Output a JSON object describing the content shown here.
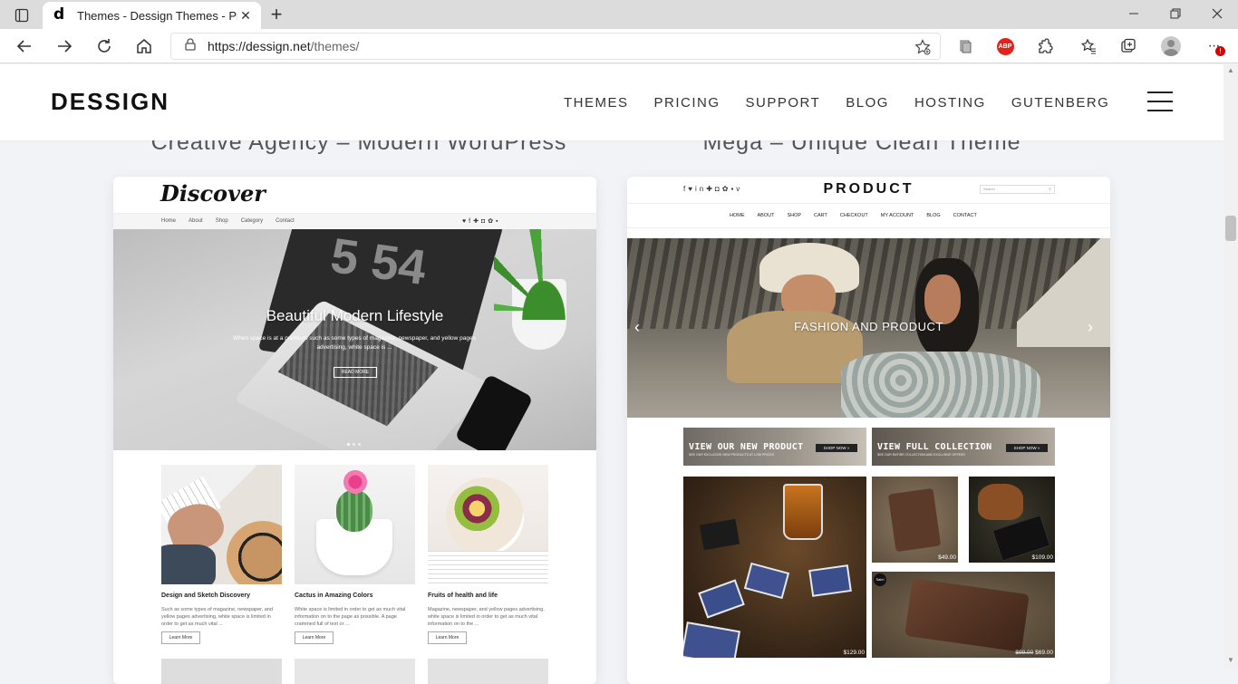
{
  "browser": {
    "tab_title": "Themes - Dessign Themes - Prem",
    "url_host": "https://dessign.net",
    "url_path": "/themes/",
    "abp_label": "ABP",
    "notif_badge": "!"
  },
  "site": {
    "logo": "DESSIGN",
    "nav": [
      "THEMES",
      "PRICING",
      "SUPPORT",
      "BLOG",
      "HOSTING",
      "GUTENBERG"
    ]
  },
  "cards": [
    {
      "title": "Creative Agency – Modern WordPress",
      "preview": {
        "brand": "Discover",
        "menu": [
          "Home",
          "About",
          "Shop",
          "Category",
          "Contact"
        ],
        "hero_title": "Beautiful Modern Lifestyle",
        "hero_text": "When space is at a premium such as some types of magazine, newspaper, and yellow pages advertising, white space is ...",
        "hero_button": "READ MORE",
        "posts": [
          {
            "title": "Design and Sketch Discovery",
            "text": "Such as some types of magazine, newspaper, and yellow pages advertising, white space is limited in order to get as much vital ...",
            "button": "Learn More"
          },
          {
            "title": "Cactus in Amazing Colors",
            "text": "White space is limited in order to get as much vital information on to the page as possible. A page crammed full of text or ...",
            "button": "Learn More"
          },
          {
            "title": "Fruits of health and life",
            "text": "Magazine, newspaper, and yellow pages advertising, white space is limited in order to get as much vital information on to the ...",
            "button": "Learn More"
          }
        ]
      }
    },
    {
      "title": "Mega – Unique Clean Theme",
      "preview": {
        "brand": "PRODUCT",
        "search_placeholder": "Search",
        "menu": [
          "HOME",
          "ABOUT",
          "SHOP",
          "CART",
          "CHECKOUT",
          "MY ACCOUNT",
          "BLOG",
          "CONTACT"
        ],
        "hero_title": "FASHION AND PRODUCT",
        "banners": [
          {
            "title": "VIEW OUR NEW PRODUCT",
            "sub": "SEE OUR EXCLUSIVE NEW PRODUCTS AT LOW PRICES",
            "button": "SHOP NOW »"
          },
          {
            "title": "VIEW FULL COLLECTION",
            "sub": "SEE OUR ENTIRE COLLECTION AND EXCLUSIVE OFFERS",
            "button": "SHOP NOW »"
          }
        ],
        "products": [
          {
            "price": "$129.00"
          },
          {
            "price": "$49.00"
          },
          {
            "price": "$109.00"
          },
          {
            "sale": "Sale!",
            "old_price": "$99.00",
            "price": "$69.00"
          }
        ]
      }
    }
  ],
  "colors": {
    "page_bg": "#f1f3f7",
    "accent_abp": "#e2231a"
  }
}
